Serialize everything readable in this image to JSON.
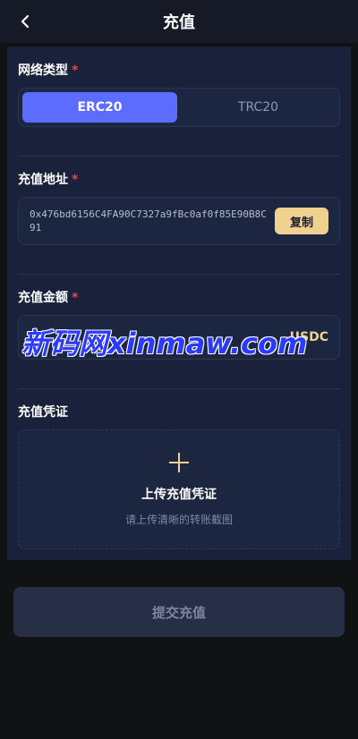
{
  "header": {
    "title": "充值",
    "back_icon": "chevron-left-icon"
  },
  "network": {
    "label": "网络类型",
    "required_mark": "*",
    "options": [
      {
        "label": "ERC20",
        "selected": true
      },
      {
        "label": "TRC20",
        "selected": false
      }
    ]
  },
  "address": {
    "label": "充值地址",
    "required_mark": "*",
    "value": "0x476bd6156C4FA90C7327a9fBc0af0f85E90B8C91",
    "copy_label": "复制"
  },
  "amount": {
    "label": "充值金额",
    "required_mark": "*",
    "placeholder": "",
    "unit": "USDC"
  },
  "watermark": {
    "text": "新码网xinmaw.com"
  },
  "proof": {
    "label": "充值凭证",
    "upload_title": "上传充值凭证",
    "upload_hint": "请上传清晰的转账截图",
    "icon": "plus-icon"
  },
  "submit": {
    "label": "提交充值"
  },
  "colors": {
    "accent": "#5b6cff",
    "gold": "#f1d18f",
    "required": "#ee4444",
    "card_bg": "#19223a",
    "page_bg": "#111214"
  }
}
